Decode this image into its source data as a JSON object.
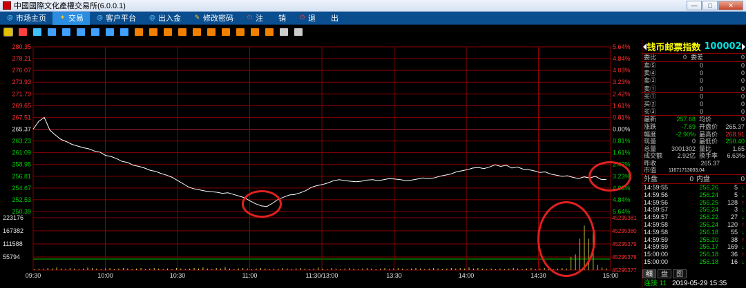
{
  "window": {
    "title": "中國國際文化產權交易所(6.0.0.1)"
  },
  "menu": [
    {
      "label": "市场主页",
      "icon": "home-icon",
      "active": false
    },
    {
      "label": "交易",
      "icon": "trade-icon",
      "active": true
    },
    {
      "label": "客户平台",
      "icon": "client-icon",
      "active": false
    },
    {
      "label": "出入金",
      "icon": "funds-icon",
      "active": false
    },
    {
      "label": "修改密码",
      "icon": "key-icon",
      "active": false
    },
    {
      "label": "注　　销",
      "icon": "logout-icon",
      "active": false
    },
    {
      "label": "退　　出",
      "icon": "exit-icon",
      "active": false
    }
  ],
  "toolbar_icons": [
    "timeshare-chart-icon",
    "kline-icon",
    "volume-icon",
    "list-icon",
    "grid-icon",
    "week-icon",
    "month-icon",
    "season-icon",
    "x-icon",
    "tool1-icon",
    "tool2-icon",
    "tool3-icon",
    "tool4-icon",
    "tool5-icon",
    "tool6-icon",
    "tool7-icon",
    "tool8-icon",
    "tool9-icon",
    "tool10-icon",
    "draw-icon",
    "settings-icon"
  ],
  "chart_data": {
    "type": "line",
    "price_ticks": [
      "280.35",
      "278.21",
      "276.07",
      "273.93",
      "271.79",
      "269.65",
      "267.51",
      "265.37",
      "263.23",
      "261.09",
      "258.95",
      "256.81",
      "254.67",
      "252.53",
      "250.39"
    ],
    "pct_ticks": [
      "5.64%",
      "4.84%",
      "4.03%",
      "3.23%",
      "2.42%",
      "1.61%",
      "0.81%",
      "0.00%",
      "0.81%",
      "1.61%",
      "2.42%",
      "3.23%",
      "4.03%",
      "4.84%",
      "5.64%"
    ],
    "volume_ticks": [
      "223176",
      "167382",
      "111588",
      "55794"
    ],
    "hold_ticks": [
      "45295381",
      "45295380",
      "45295379",
      "45295378",
      "45295377"
    ],
    "time_ticks": [
      "09:30",
      "10:00",
      "10:30",
      "11:00",
      "11:30/13:00",
      "13:30",
      "14:00",
      "14:30",
      "15:00"
    ],
    "ylim": [
      250.39,
      280.35
    ],
    "prev_close": 265.37,
    "colors": {
      "up": "#ff3030",
      "down": "#00d000",
      "line": "#ffffff",
      "grid": "#8b0000",
      "vol": "#d0d040"
    },
    "price": [
      265.37,
      266.8,
      267.5,
      265.2,
      264.3,
      263.5,
      263.1,
      262.6,
      262.3,
      262.0,
      261.8,
      261.4,
      261.2,
      260.6,
      260.4,
      260.0,
      259.5,
      259.3,
      258.8,
      258.6,
      258.3,
      257.9,
      257.7,
      257.3,
      257.0,
      256.6,
      256.0,
      255.4,
      254.8,
      254.5,
      254.3,
      254.1,
      254.0,
      253.9,
      253.7,
      253.8,
      253.5,
      253.2,
      252.9,
      252.3,
      251.8,
      251.4,
      251.3,
      251.9,
      252.6,
      253.0,
      253.4,
      253.5,
      253.8,
      254.2,
      254.8,
      255.1,
      255.3,
      255.6,
      256.0,
      256.2,
      256.0,
      255.9,
      255.8,
      255.9,
      256.1,
      256.2,
      256.0,
      256.2,
      256.4,
      256.3,
      256.2,
      256.0,
      256.1,
      256.3,
      256.5,
      256.4,
      256.5,
      256.8,
      257.0,
      257.2,
      257.6,
      257.8,
      258.0,
      258.3,
      258.4,
      258.2,
      258.5,
      258.9,
      258.6,
      258.8,
      258.3,
      258.5,
      258.1,
      258.0,
      257.8,
      257.5,
      257.6,
      257.2,
      257.0,
      256.8,
      256.9,
      256.6,
      256.4,
      256.7,
      256.5,
      256.8,
      256.26,
      256.18
    ],
    "volume": [
      2,
      3,
      2,
      4,
      3,
      5,
      3,
      2,
      4,
      3,
      2,
      3,
      5,
      4,
      3,
      2,
      3,
      4,
      2,
      3,
      4,
      3,
      2,
      3,
      4,
      2,
      3,
      4,
      3,
      2,
      3,
      2,
      4,
      3,
      2,
      3,
      4,
      3,
      5,
      3,
      2,
      4,
      3,
      6,
      3,
      2,
      3,
      4,
      3,
      2,
      3,
      4,
      3,
      2,
      3,
      2,
      4,
      3,
      2,
      3,
      4,
      3,
      2,
      3,
      5,
      3,
      2,
      4,
      3,
      2,
      3,
      4,
      3,
      2,
      3,
      4,
      3,
      2,
      3,
      4,
      2,
      3,
      4,
      3,
      2,
      3,
      4,
      3,
      2,
      3,
      4,
      3,
      2,
      3,
      4,
      3,
      4,
      3,
      5,
      3,
      4,
      3,
      2,
      3,
      2,
      3,
      2,
      3,
      4,
      3,
      2,
      3,
      4,
      2,
      3,
      4,
      3,
      2,
      3,
      4,
      3,
      25,
      30,
      60,
      85,
      60,
      75,
      10,
      5,
      3
    ]
  },
  "panel": {
    "name": "钱币邮票指数",
    "code": "100002",
    "order_book": [
      {
        "label": "委比",
        "v1": "0",
        "l2": "委差",
        "v2": "0"
      },
      {
        "label": "卖⑤",
        "v1": "0",
        "v2": "0"
      },
      {
        "label": "卖④",
        "v1": "0",
        "v2": "0"
      },
      {
        "label": "卖②",
        "v1": "0",
        "v2": "0"
      },
      {
        "label": "卖①",
        "v1": "0",
        "v2": "0"
      },
      {
        "label": "买①",
        "v1": "0",
        "v2": "0"
      },
      {
        "label": "买②",
        "v1": "0",
        "v2": "0"
      },
      {
        "label": "买③",
        "v1": "0",
        "v2": "0"
      }
    ],
    "stats": [
      {
        "l1": "最新",
        "v1": "257.68",
        "c1": "green",
        "l2": "均价",
        "v2": "0",
        "c2": ""
      },
      {
        "l1": "涨跌",
        "v1": "-7.69",
        "c1": "green",
        "l2": "开盘价",
        "v2": "265.37",
        "c2": ""
      },
      {
        "l1": "幅度",
        "v1": "-2.90%",
        "c1": "green",
        "l2": "最高价",
        "v2": "268.91",
        "c2": "red"
      },
      {
        "l1": "现量",
        "v1": "0",
        "c1": "",
        "l2": "最低价",
        "v2": "250.40",
        "c2": "green"
      },
      {
        "l1": "总量",
        "v1": "3001302",
        "c1": "",
        "l2": "量比",
        "v2": "1.65",
        "c2": ""
      },
      {
        "l1": "成交额",
        "v1": "2.92亿",
        "c1": "",
        "l2": "换手率",
        "v2": "6.63%",
        "c2": ""
      },
      {
        "l1": "昨收",
        "v1": "265.37",
        "c1": "",
        "l2": "",
        "v2": "",
        "c2": ""
      },
      {
        "l1": "市值",
        "v1": "11671713003.04",
        "c1": "",
        "l2": "",
        "v2": "",
        "c2": ""
      }
    ],
    "outer_label": "外盘",
    "outer_value": "0",
    "inner_label": "内盘",
    "inner_value": "0",
    "ticks": [
      {
        "t": "14:59:55",
        "p": "256.26",
        "v": "5",
        "d": "↓"
      },
      {
        "t": "14:59:56",
        "p": "256.24",
        "v": "5",
        "d": "↓"
      },
      {
        "t": "14:59:56",
        "p": "256.25",
        "v": "128",
        "d": "↑"
      },
      {
        "t": "14:59:57",
        "p": "256.24",
        "v": "3",
        "d": "↓"
      },
      {
        "t": "14:59:57",
        "p": "256.22",
        "v": "27",
        "d": "↓"
      },
      {
        "t": "14:59:58",
        "p": "256.24",
        "v": "120",
        "d": "↑"
      },
      {
        "t": "14:59:58",
        "p": "256.18",
        "v": "55",
        "d": "↓"
      },
      {
        "t": "14:59:59",
        "p": "256.20",
        "v": "38",
        "d": "↑"
      },
      {
        "t": "14:59:59",
        "p": "256.17",
        "v": "169",
        "d": "↓"
      },
      {
        "t": "15:00:00",
        "p": "256.18",
        "v": "36",
        "d": "↑"
      },
      {
        "t": "15:00:00",
        "p": "256.18",
        "v": "16",
        "d": "↓"
      }
    ],
    "tabs": [
      "细",
      "盘",
      "图"
    ],
    "status_conn": "连接 11",
    "status_datetime": "2019-05-29 15:35"
  }
}
